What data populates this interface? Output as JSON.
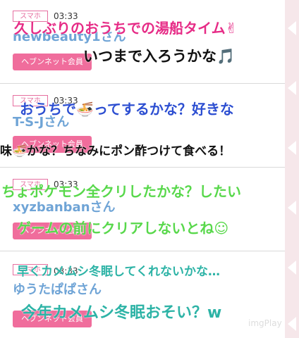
{
  "posts": [
    {
      "device": "スマホ",
      "time": "03:33",
      "user": "newbeauty1さん",
      "tag": "ヘブンネット会員"
    },
    {
      "device": "スマホ",
      "time": "03:33",
      "user": "T-S-Jさん",
      "tag": "ヘブンネット会員"
    },
    {
      "device": "スマホ",
      "time": "03:33",
      "user": "xyzbanbanさん",
      "tag": "ヘブンネット会員"
    },
    {
      "device": "スマホ",
      "time": "03:33",
      "user": "ゆうたぱぱさん",
      "tag": "ヘブンネット会員"
    }
  ],
  "overlay_texts": [
    "久しぶりのおうちでの湯船タイム✌",
    "いつまで入ろうかな🎵",
    "おうちで🍜ってするかな？好きな",
    "味🍜かな？ちなみにポン酢つけて食べる！",
    "ちょポケモン全クリしたかな？したい",
    "ゲームの前にクリアしないとね☺",
    "早くカメムシ冬眠してくれないかな…",
    "今年カメムシ冬眠おそい？w"
  ],
  "watermark": "imgPlay"
}
